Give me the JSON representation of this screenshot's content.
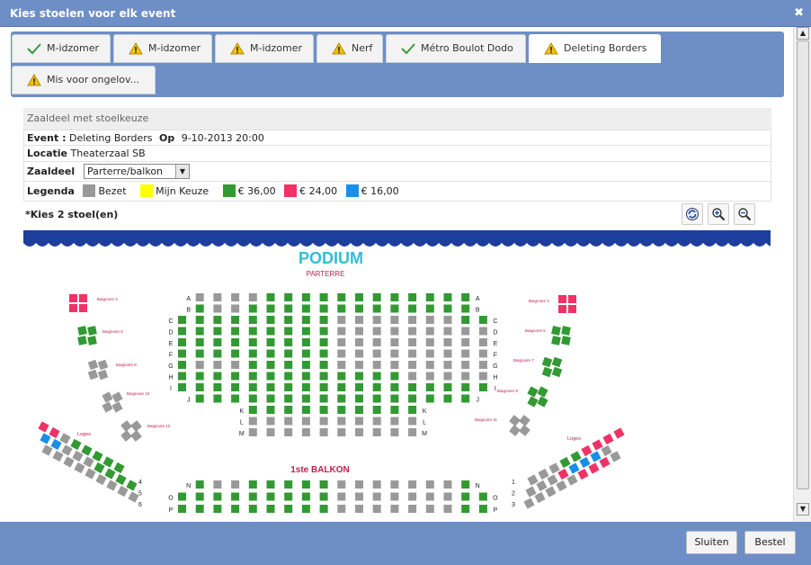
{
  "window": {
    "title": "Kies stoelen voor elk event",
    "close_glyph": "✖"
  },
  "tabs": [
    {
      "label": "M-idzomer",
      "status": "check-icon"
    },
    {
      "label": "M-idzomer",
      "status": "warning-icon"
    },
    {
      "label": "M-idzomer",
      "status": "warning-icon"
    },
    {
      "label": "Nerf",
      "status": "warning-icon"
    },
    {
      "label": "Métro Boulot Dodo",
      "status": "check-icon"
    },
    {
      "label": "Deleting Borders",
      "status": "warning-icon",
      "active": true
    },
    {
      "label": "Mis voor ongelov...",
      "status": "warning-icon"
    }
  ],
  "panel": {
    "section_title": "Zaaldeel met stoelkeuze",
    "event_label": "Event :",
    "event_value": "Deleting Borders",
    "op_label": "Op",
    "date_value": "9-10-2013 20:00",
    "locatie_label": "Locatie",
    "locatie_value": "Theaterzaal SB",
    "zaaldeel_label": "Zaaldeel",
    "zaaldeel_value": "Parterre/balkon",
    "legenda_label": "Legenda",
    "legend": [
      {
        "label": "Bezet",
        "color": "#999999"
      },
      {
        "label": "Mijn Keuze",
        "color": "#ffff00"
      },
      {
        "label": "€ 36,00",
        "color": "#339933"
      },
      {
        "label": "€ 24,00",
        "color": "#ee3366"
      },
      {
        "label": "€ 16,00",
        "color": "#1a8fe8"
      }
    ],
    "instruction": "*Kies 2 stoel(en)"
  },
  "toolbar": {
    "refresh_icon": "refresh-icon",
    "zoom_in_icon": "zoom-in-icon",
    "zoom_out_icon": "zoom-out-icon"
  },
  "plan": {
    "stage_label": "PODIUM",
    "parterre_label": "PARTERRE",
    "balkon_label": "1ste BALKON",
    "row_letters": [
      "A",
      "B",
      "C",
      "D",
      "E",
      "F",
      "G",
      "H",
      "I",
      "J",
      "K",
      "L",
      "M"
    ],
    "balkon_rows": [
      "N",
      "O",
      "P"
    ],
    "box_labels_left": [
      "Baignoire 4",
      "Baignoire 6",
      "Baignoire 8",
      "Baignoire 10",
      "Baignoire 12",
      "Loges"
    ],
    "box_labels_right": [
      "Baignoire 3",
      "Baignoire 5",
      "Baignoire 7",
      "Baignoire 9",
      "Baignoire 11",
      "Loges"
    ],
    "loge_rows_left": [
      "4",
      "5",
      "6"
    ],
    "loge_rows_right": [
      "1",
      "2",
      "3"
    ]
  },
  "buttons": {
    "close": "Sluiten",
    "order": "Bestel"
  }
}
